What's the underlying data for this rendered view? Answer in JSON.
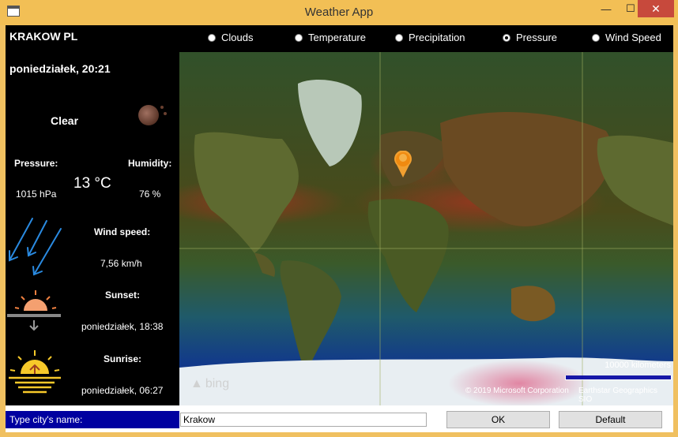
{
  "window": {
    "title": "Weather App"
  },
  "weather": {
    "city": "KRAKOW PL",
    "datetime": "poniedziałek, 20:21",
    "condition": "Clear",
    "condition_icon": "moon-icon",
    "pressure_label": "Pressure:",
    "pressure_value": "1015 hPa",
    "temperature": "13 °C",
    "humidity_label": "Humidity:",
    "humidity_value": "76 %",
    "wind_label": "Wind speed:",
    "wind_value": "7,56 km/h",
    "sunset_label": "Sunset:",
    "sunset_value": "poniedziałek, 18:38",
    "sunrise_label": "Sunrise:",
    "sunrise_value": "poniedziałek, 06:27"
  },
  "layers": [
    {
      "label": "Clouds",
      "selected": false
    },
    {
      "label": "Temperature",
      "selected": false
    },
    {
      "label": "Precipitation",
      "selected": false
    },
    {
      "label": "Pressure",
      "selected": true
    },
    {
      "label": "Wind Speed",
      "selected": false
    }
  ],
  "map": {
    "brand": "bing",
    "scale_label": "10000 kilometers",
    "copyright": "© 2019 Microsoft Corporation",
    "copyright2": "Earthstar Geographics SIO"
  },
  "search": {
    "label": "Type city's name:",
    "value": "Krakow",
    "ok_label": "OK",
    "default_label": "Default"
  },
  "colors": {
    "titlebar": "#f2bf55",
    "label_bg": "#0000a0",
    "close": "#c7493c"
  }
}
